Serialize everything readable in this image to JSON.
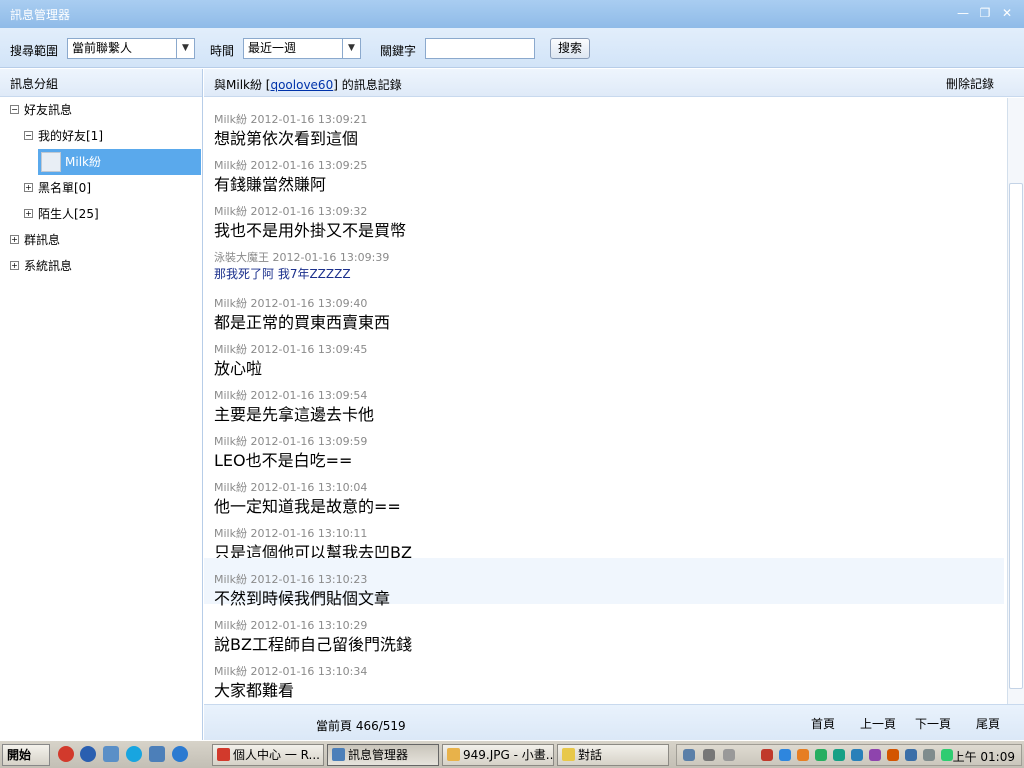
{
  "window": {
    "title": "訊息管理器"
  },
  "toolbar": {
    "scope_label": "搜尋範圍",
    "scope_value": "當前聯繫人",
    "time_label": "時間",
    "time_value": "最近一週",
    "keyword_label": "關鍵字",
    "keyword_value": "",
    "search_button": "搜索"
  },
  "sidebar": {
    "header": "訊息分組",
    "friends": "好友訊息",
    "my_friends": "我的好友[1]",
    "contact": "Milk紛",
    "blacklist": "黑名單[0]",
    "strangers": "陌生人[25]",
    "groups": "群訊息",
    "system": "系統訊息"
  },
  "history": {
    "header_prefix": "與Milk紛 [",
    "header_link": "qoolove60",
    "header_suffix": "] 的訊息記錄",
    "delete": "刪除記錄"
  },
  "messages": [
    {
      "sender": "Milk紛",
      "time": "2012-01-16 13:09:21",
      "text": "想說第依次看到這個"
    },
    {
      "sender": "Milk紛",
      "time": "2012-01-16 13:09:25",
      "text": "有錢賺當然賺阿"
    },
    {
      "sender": "Milk紛",
      "time": "2012-01-16 13:09:32",
      "text": "我也不是用外掛又不是買幣"
    },
    {
      "sender": "泳裝大魔王",
      "time": "2012-01-16 13:09:39",
      "text": "那我死了阿  我7年ZZZZZ"
    },
    {
      "sender": "Milk紛",
      "time": "2012-01-16 13:09:40",
      "text": "都是正常的買東西賣東西"
    },
    {
      "sender": "Milk紛",
      "time": "2012-01-16 13:09:45",
      "text": "放心啦"
    },
    {
      "sender": "Milk紛",
      "time": "2012-01-16 13:09:54",
      "text": "主要是先拿這邊去卡他"
    },
    {
      "sender": "Milk紛",
      "time": "2012-01-16 13:09:59",
      "text": "LEO也不是白吃=="
    },
    {
      "sender": "Milk紛",
      "time": "2012-01-16 13:10:04",
      "text": "他一定知道我是故意的=="
    },
    {
      "sender": "Milk紛",
      "time": "2012-01-16 13:10:11",
      "text": "只是這個他可以幫我去凹BZ"
    },
    {
      "sender": "Milk紛",
      "time": "2012-01-16 13:10:23",
      "text": "不然到時候我們貼個文章"
    },
    {
      "sender": "Milk紛",
      "time": "2012-01-16 13:10:29",
      "text": "說BZ工程師自己留後門洗錢"
    },
    {
      "sender": "Milk紛",
      "time": "2012-01-16 13:10:34",
      "text": "大家都難看"
    }
  ],
  "footer": {
    "page_info": "當前頁 466/519",
    "first": "首頁",
    "prev": "上一頁",
    "next": "下一頁",
    "last": "尾頁"
  },
  "taskbar": {
    "start": "開始",
    "tasks": [
      "個人中心 一 R...",
      "訊息管理器",
      "949.JPG - 小畫...",
      "對話"
    ],
    "clock": "上午 01:09"
  }
}
